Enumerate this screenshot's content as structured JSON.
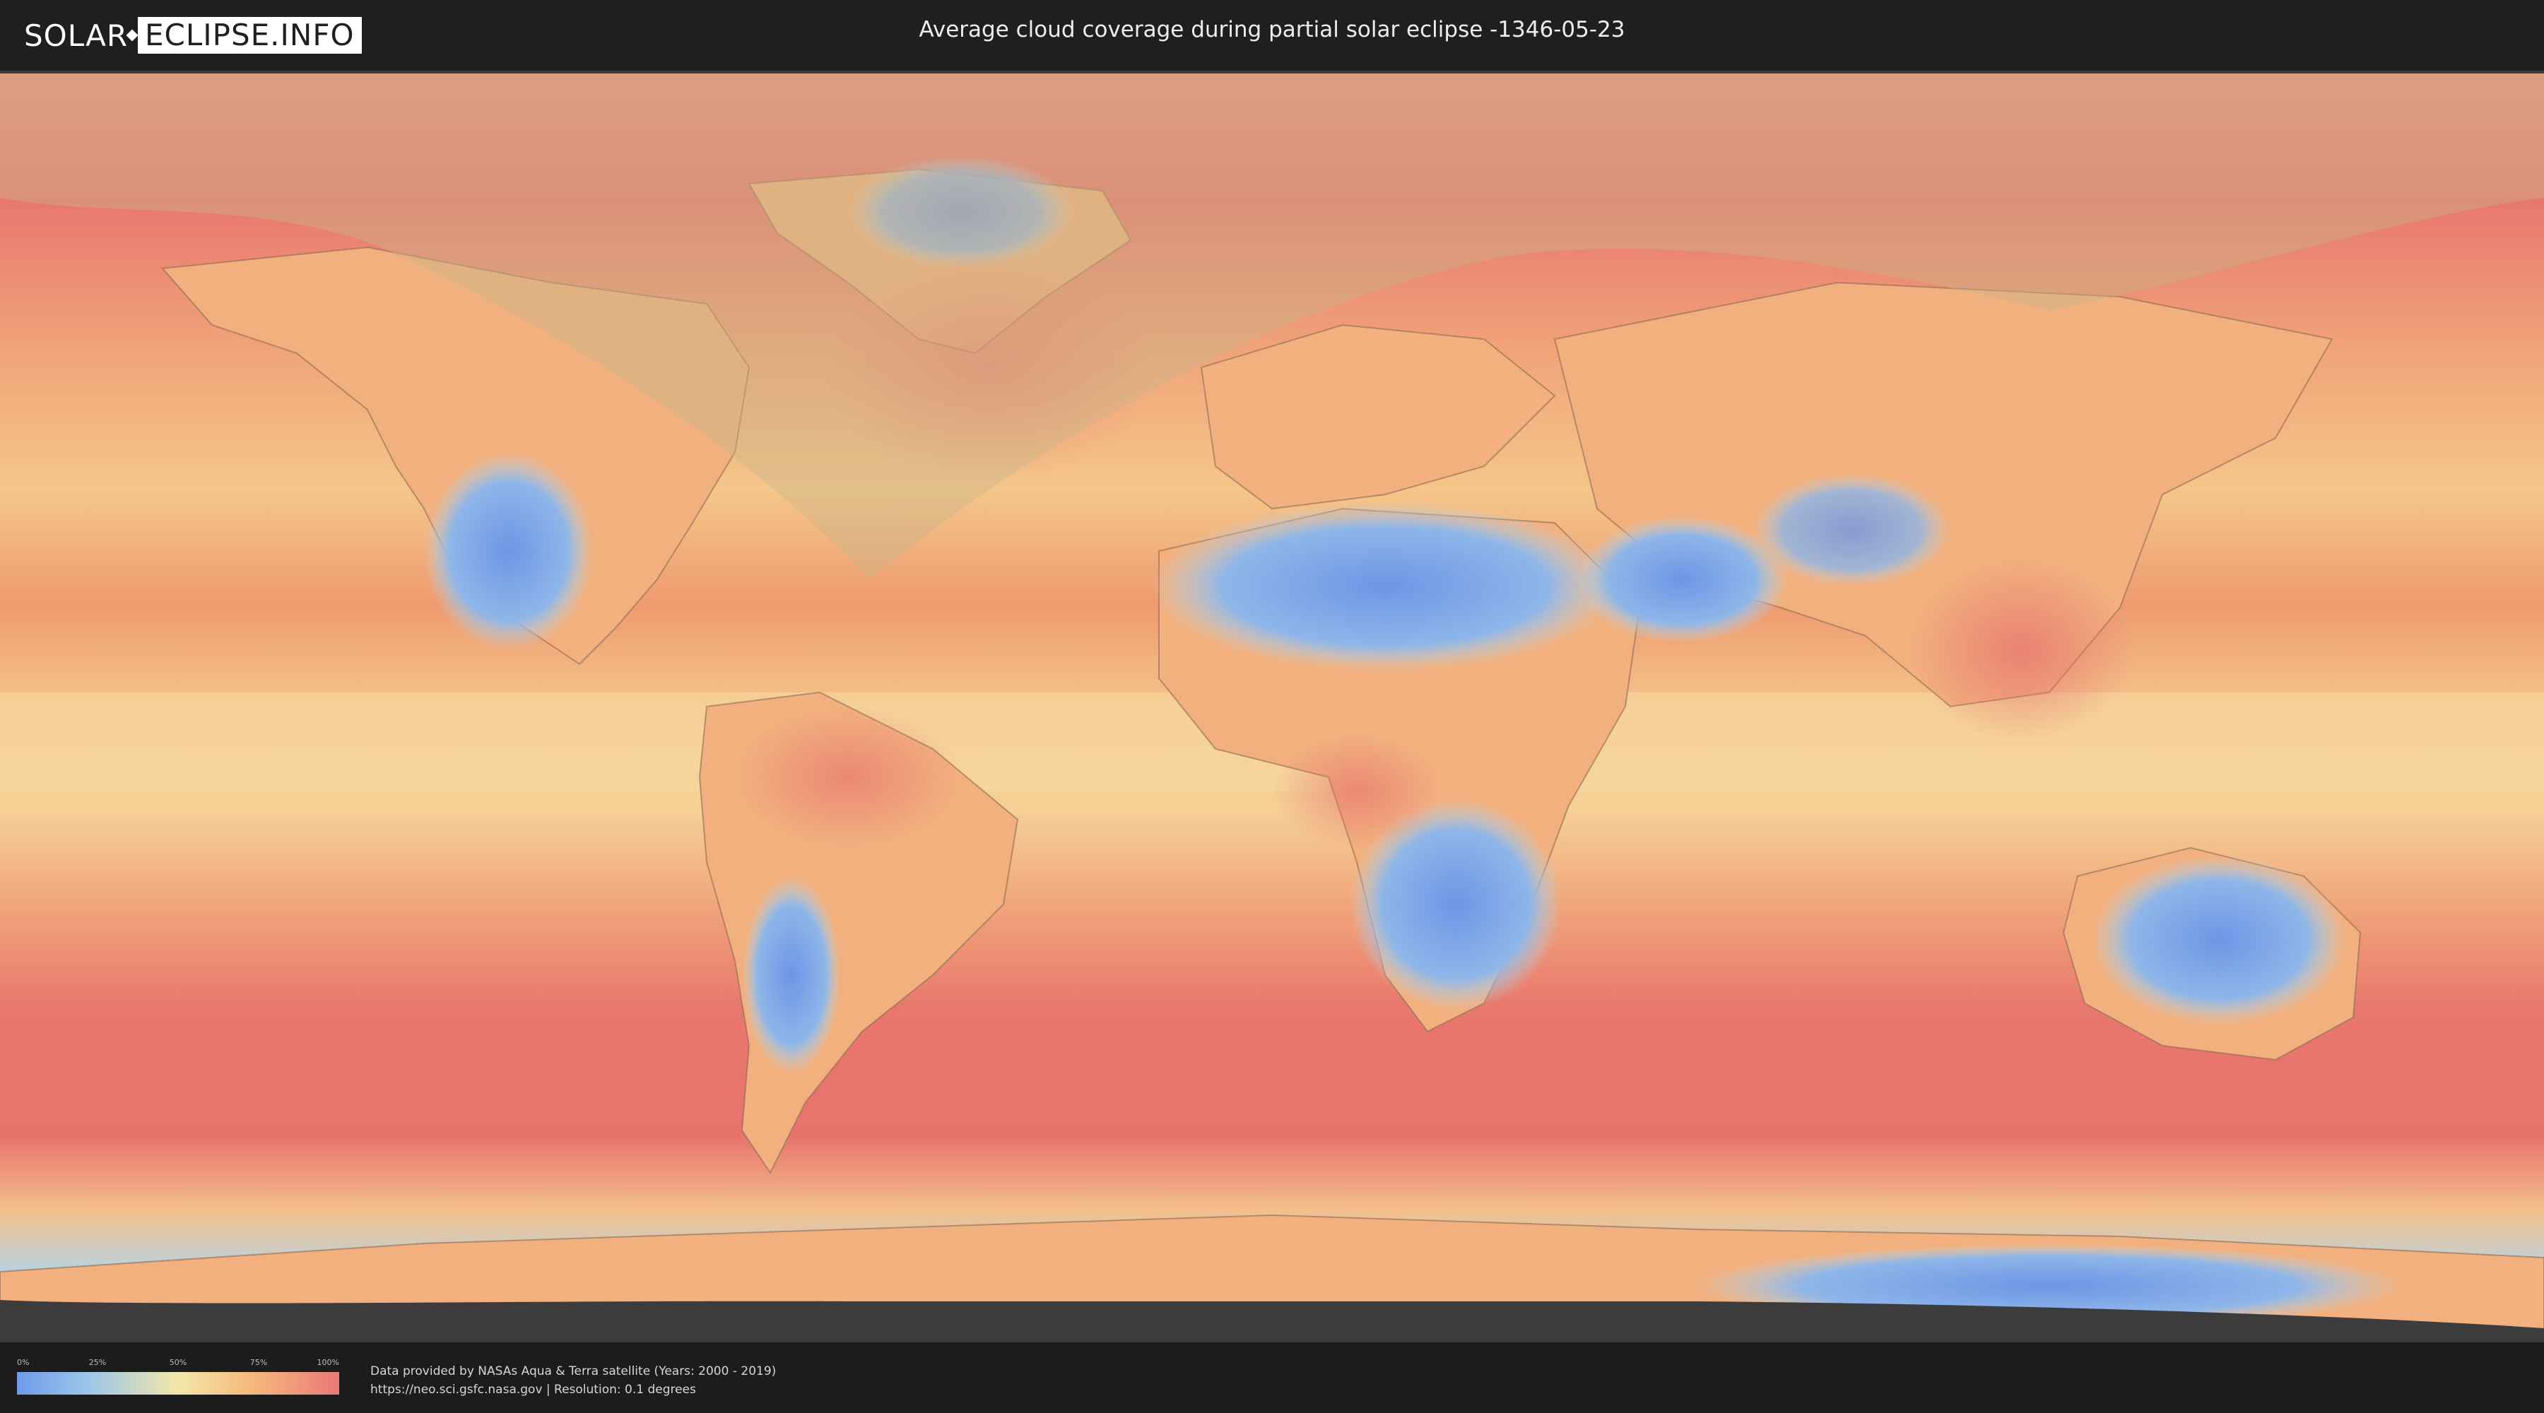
{
  "header": {
    "logo_left": "SOLAR",
    "logo_right": "ECLIPSE.INFO",
    "title": "Average cloud coverage during partial solar eclipse -1346-05-23"
  },
  "legend": {
    "ticks": [
      "0%",
      "25%",
      "50%",
      "75%",
      "100%"
    ],
    "tick_values": [
      0,
      25,
      50,
      75,
      100
    ],
    "colors": [
      "#6f9bea",
      "#9cc6e8",
      "#f3e6a8",
      "#f4b97c",
      "#ea7a78"
    ]
  },
  "credits": {
    "line1": "Data provided by NASAs Aqua & Terra satellite (Years: 2000 - 2019)",
    "line2": "https://neo.sci.gsfc.nasa.gov | Resolution: 0.1 degrees"
  },
  "map": {
    "eclipse_shadow_color": "#c8b489"
  }
}
